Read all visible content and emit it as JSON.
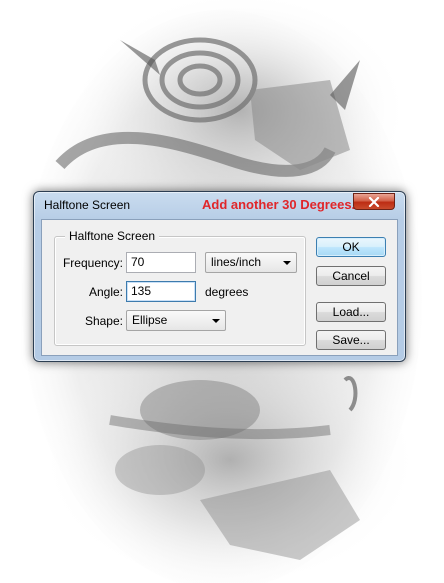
{
  "dialog": {
    "title": "Halftone Screen",
    "annotation": "Add another 30 Degrees.",
    "close_icon": "close-icon",
    "group": {
      "legend": "Halftone Screen",
      "frequency": {
        "label": "Frequency:",
        "value": "70",
        "unit_selected": "lines/inch"
      },
      "angle": {
        "label": "Angle:",
        "value": "135",
        "unit": "degrees"
      },
      "shape": {
        "label": "Shape:",
        "selected": "Ellipse"
      }
    },
    "buttons": {
      "ok": "OK",
      "cancel": "Cancel",
      "load": "Load...",
      "save": "Save..."
    }
  },
  "colors": {
    "annotation": "#e0262a",
    "title_bar": "#b7cde6",
    "close_button": "#c94a2c"
  }
}
